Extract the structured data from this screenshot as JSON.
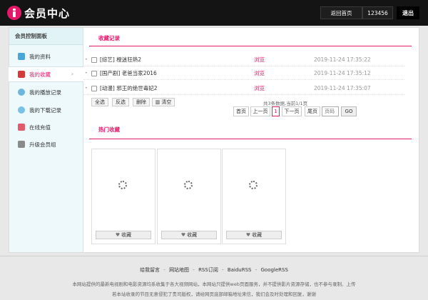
{
  "header": {
    "logo_text": "会员中心",
    "home_label": "返回首页",
    "username": "123456",
    "logout_label": "退出"
  },
  "sidebar": {
    "title": "会员控制面板",
    "items": [
      {
        "label": "我的资料",
        "icon": "user-icon"
      },
      {
        "label": "我的收藏",
        "icon": "heart-icon"
      },
      {
        "label": "我的播放记录",
        "icon": "play-icon"
      },
      {
        "label": "我的下载记录",
        "icon": "cloud-icon"
      },
      {
        "label": "在线充值",
        "icon": "mail-icon"
      },
      {
        "label": "升级会员组",
        "icon": "puzzle-icon"
      }
    ],
    "active_arrow": "›"
  },
  "favorites": {
    "section_title": "收藏记录",
    "records": [
      {
        "title": "[综艺] 橙迷狂熱2",
        "action": "浏览",
        "time": "2019-11-24 17:35:22"
      },
      {
        "title": "[国产剧] 老爸当家2016",
        "action": "浏览",
        "time": "2019-11-24 17:35:12"
      },
      {
        "title": "[动漫] 邪王的绝世毒妃2",
        "action": "浏览",
        "time": "2019-11-24 17:35:07"
      }
    ],
    "actions": {
      "select_all": "全选",
      "invert": "反选",
      "delete": "删除",
      "clear": "清空"
    },
    "count_text": "共3条数据,当前1/1页",
    "pagination": {
      "first": "首页",
      "prev": "上一页",
      "current": "1",
      "next": "下一页",
      "last": "尾页",
      "page_placeholder": "页码",
      "go": "GO"
    }
  },
  "hot": {
    "section_title": "热门收藏",
    "cards": [
      {
        "button": "收藏"
      },
      {
        "button": "收藏"
      },
      {
        "button": "收藏"
      }
    ]
  },
  "footer": {
    "links": [
      "给我留言",
      "网站地图",
      "RSS订阅",
      "BaiduRSS",
      "GoogleRSS"
    ],
    "separator": "-",
    "note1": "本网站提供的最新电视剧和电影资源均系收集于各大视频网站，本网站只提供web页面服务，并不提供影片资源存储，也不参与录制、上传",
    "note2": "若本站收录的节目无意侵犯了贵司版权，请给网页底部邮箱地址来信，我们会及时处理和回复，谢谢"
  },
  "colors": {
    "accent": "#e6186a",
    "header_bg": "#141414",
    "sidebar_bg": "#edf9fb"
  }
}
